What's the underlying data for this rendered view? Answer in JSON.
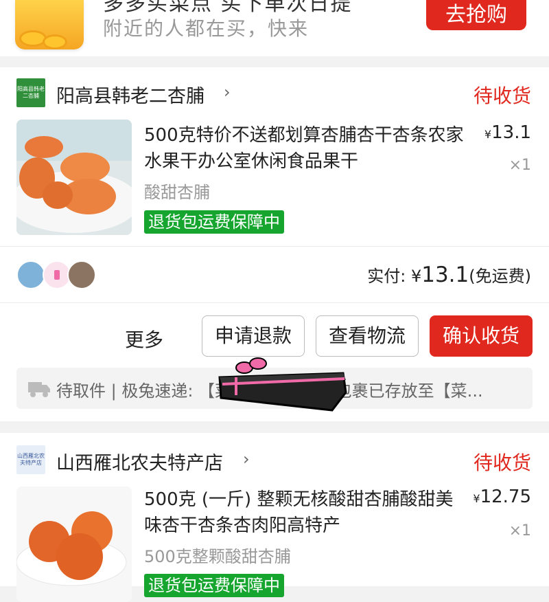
{
  "promo": {
    "headline": "多多买菜点 买下单次日提",
    "subline": "附近的人都在买，快来",
    "button": "去抢购"
  },
  "orders": [
    {
      "shop_logo_text": "阳高县韩老二杏脯",
      "shop_name": "阳高县韩老二杏脯",
      "status": "待收货",
      "title": "500克特价不送都划算杏脯杏干杏条农家水果干办公室休闲食品果干",
      "variant": "酸甜杏脯",
      "currency": "¥",
      "price": "13.1",
      "qty": "×1",
      "guarantee": "退货包运费保障中",
      "paid_label": "实付:",
      "paid_amount": "13.1",
      "shipping_note": "(免运费)",
      "more_label": "更多",
      "buttons": {
        "refund": "申请退款",
        "logistics": "查看物流",
        "confirm": "确认收货"
      },
      "tracking": "待取件 | 极兔速递: 【菜鸟驿站】 您的包裹已存放至【菜..."
    },
    {
      "shop_logo_text": "山西雁北农夫特产店",
      "shop_name": "山西雁北农夫特产店",
      "status": "待收货",
      "title": "500克 (一斤) 整颗无核酸甜杏脯酸甜美味杏干杏条杏肉阳高特产",
      "variant": "500克整颗酸甜杏脯",
      "currency": "¥",
      "price": "12.75",
      "qty": "×1",
      "guarantee": "退货包运费保障中"
    }
  ],
  "colors": {
    "accent_red": "#e0281e",
    "guarantee_green": "#16a62f"
  }
}
